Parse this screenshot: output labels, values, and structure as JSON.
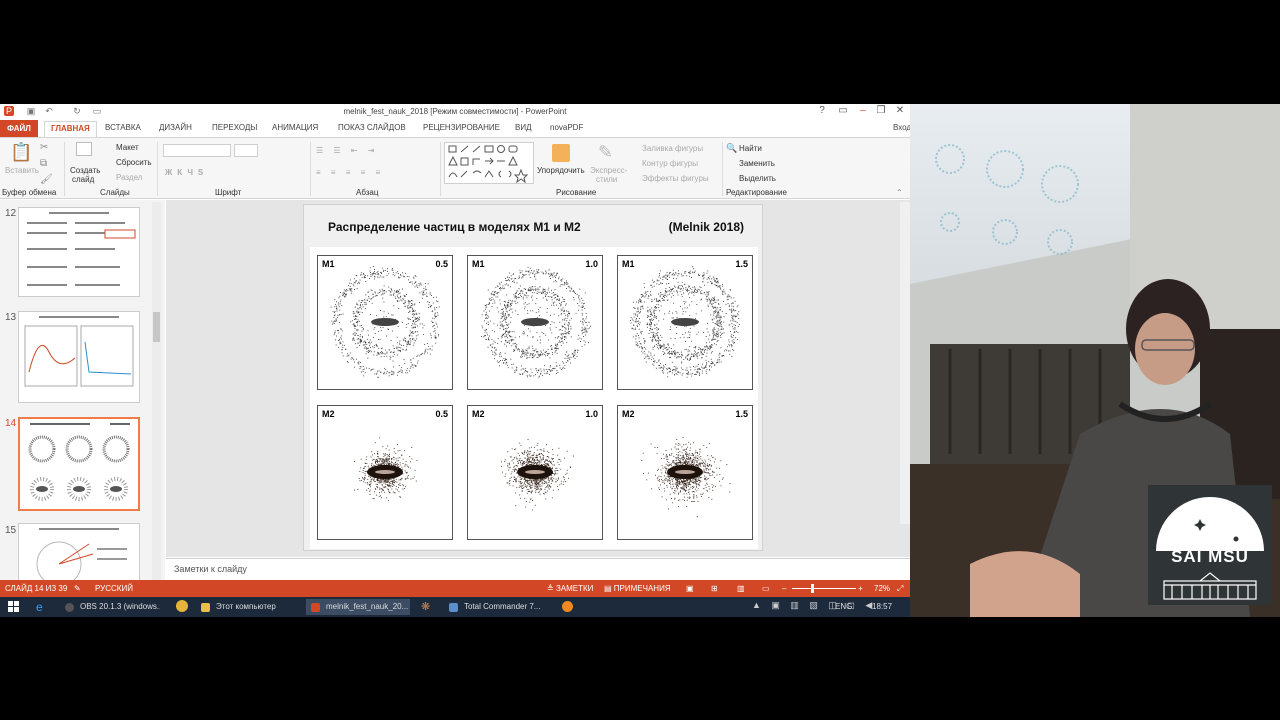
{
  "window": {
    "title": "melnik_fest_nauk_2018 [Режим совместимости] - PowerPoint",
    "signin": "Вход"
  },
  "tabs": [
    "ФАЙЛ",
    "ГЛАВНАЯ",
    "ВСТАВКА",
    "ДИЗАЙН",
    "ПЕРЕХОДЫ",
    "АНИМАЦИЯ",
    "ПОКАЗ СЛАЙДОВ",
    "РЕЦЕНЗИРОВАНИЕ",
    "ВИД",
    "novaPDF"
  ],
  "ribbon": {
    "paste": "Вставить",
    "clipboard_group": "Буфер обмена",
    "new_slide": "Создать",
    "new_slide2": "слайд",
    "layout": "Макет",
    "reset": "Сбросить",
    "section": "Раздел",
    "slides_group": "Слайды",
    "font_group": "Шрифт",
    "paragraph_group": "Абзац",
    "arrange": "Упорядочить",
    "quick_styles": "Экспресс-",
    "quick_styles2": "стили",
    "shape_fill": "Заливка фигуры",
    "shape_outline": "Контур фигуры",
    "shape_effects": "Эффекты фигуры",
    "drawing_group": "Рисование",
    "find": "Найти",
    "replace": "Заменить",
    "select": "Выделить",
    "editing_group": "Редактирование"
  },
  "thumbnails": [
    {
      "num": "12"
    },
    {
      "num": "13"
    },
    {
      "num": "14",
      "selected": true
    },
    {
      "num": "15"
    }
  ],
  "slide": {
    "title": "Распределение частиц в моделях М1 и М2",
    "citation": "(Melnik 2018)",
    "panels": [
      {
        "model": "M1",
        "value": "0.5"
      },
      {
        "model": "M1",
        "value": "1.0"
      },
      {
        "model": "M1",
        "value": "1.5"
      },
      {
        "model": "M2",
        "value": "0.5"
      },
      {
        "model": "M2",
        "value": "1.0"
      },
      {
        "model": "M2",
        "value": "1.5"
      }
    ]
  },
  "notes_placeholder": "Заметки к слайду",
  "status": {
    "slide_counter": "СЛАЙД 14 ИЗ 39",
    "language": "РУССКИЙ",
    "notes": "ЗАМЕТКИ",
    "comments": "ПРИМЕЧАНИЯ",
    "zoom": "72%"
  },
  "taskbar": {
    "items": [
      "OBS 20.1.3 (windows...",
      "Этот компьютер",
      "melnik_fest_nauk_20...",
      "Total Commander 7..."
    ],
    "lang": "ENG",
    "time": "18:57"
  },
  "logo": {
    "text": "SAI MSU"
  },
  "colors": {
    "accent": "#d24726",
    "taskbar": "#1c2a3c"
  }
}
